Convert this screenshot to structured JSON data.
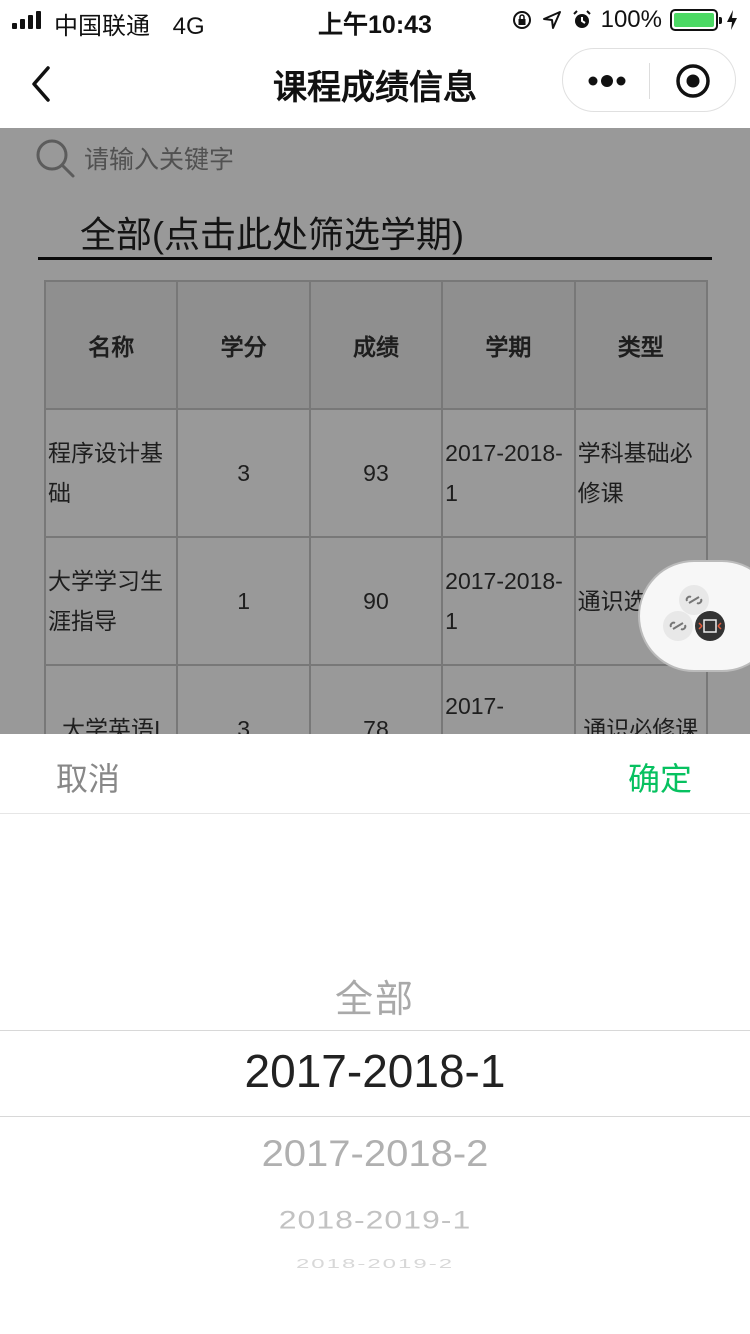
{
  "status_bar": {
    "carrier": "中国联通",
    "network": "4G",
    "time": "上午10:43",
    "battery": "100%"
  },
  "nav": {
    "title": "课程成绩信息"
  },
  "search": {
    "placeholder": "请输入关键字"
  },
  "filter": {
    "label": "全部(点击此处筛选学期)"
  },
  "table": {
    "headers": [
      "名称",
      "学分",
      "成绩",
      "学期",
      "类型"
    ],
    "rows": [
      {
        "name": "程序设计基础",
        "credit": "3",
        "score": "93",
        "term": "2017-2018-1",
        "type": "学科基础必修课"
      },
      {
        "name": "大学学习生涯指导",
        "credit": "1",
        "score": "90",
        "term": "2017-2018-1",
        "type": "通识选"
      },
      {
        "name": "大学英语I",
        "credit": "3",
        "score": "78",
        "term": "2017-",
        "type": "通识必修课"
      }
    ]
  },
  "picker": {
    "cancel": "取消",
    "confirm": "确定",
    "options": [
      "全部",
      "2017-2018-1",
      "2017-2018-2",
      "2018-2019-1",
      "2018-2019-2"
    ],
    "selected": "2017-2018-1"
  },
  "colors": {
    "accent": "#07c160",
    "battery": "#4cd964",
    "overlay": "rgba(0,0,0,0.4)"
  },
  "icons": {
    "back": "chevron-left-icon",
    "more": "more-dots-icon",
    "close": "target-close-icon",
    "search": "search-icon",
    "link": "link-icon",
    "code": "code-icon"
  }
}
